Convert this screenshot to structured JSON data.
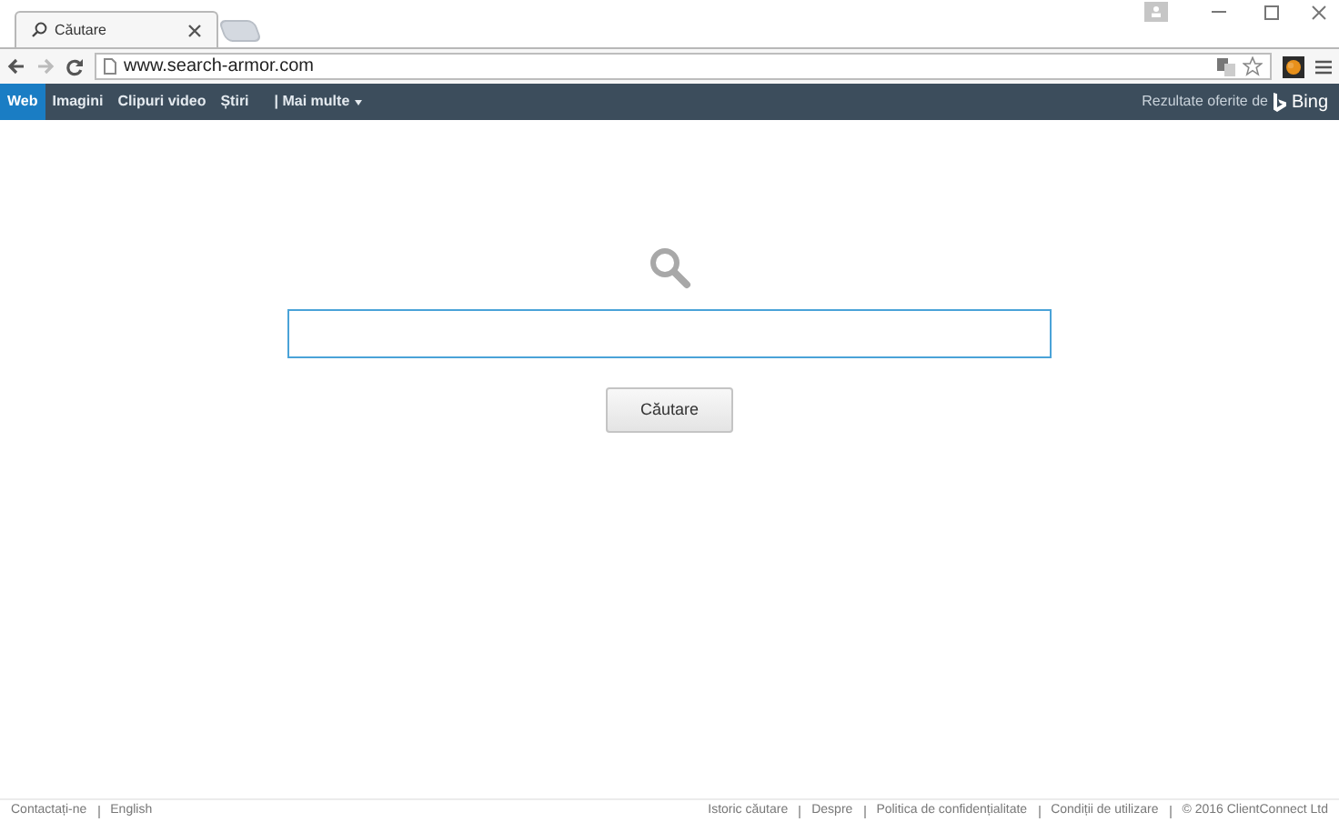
{
  "browser": {
    "tab_title": "Căutare",
    "address": "www.search-armor.com"
  },
  "nav": {
    "items": [
      {
        "label": "Web",
        "selected": true
      },
      {
        "label": "Imagini",
        "selected": false
      },
      {
        "label": "Clipuri video",
        "selected": false
      },
      {
        "label": "Știri",
        "selected": false
      },
      {
        "label": "| Mai multe",
        "selected": false
      }
    ],
    "powered_by": "Rezultate oferite de",
    "brand": "Bing"
  },
  "search": {
    "button": "Căutare"
  },
  "footer": {
    "left": [
      "Contactați-ne",
      "English"
    ],
    "right": [
      "Istoric căutare",
      "Despre",
      "Politica de confidențialitate",
      "Condiții de utilizare",
      "© 2016 ClientConnect Ltd"
    ]
  }
}
